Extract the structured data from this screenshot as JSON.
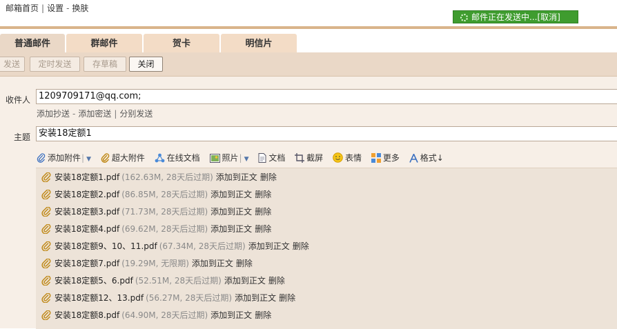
{
  "topnav": {
    "home": "邮箱首页",
    "settings": "设置",
    "skin": "换肤"
  },
  "status": {
    "text": "邮件正在发送中...",
    "cancel": "[取消]"
  },
  "tabs": [
    {
      "label": "普通邮件"
    },
    {
      "label": "群邮件"
    },
    {
      "label": "贺卡"
    },
    {
      "label": "明信片"
    }
  ],
  "toolbar": {
    "send": "发送",
    "scheduled": "定时发送",
    "draft": "存草稿",
    "close": "关闭"
  },
  "compose": {
    "to_label": "收件人",
    "to_value": "1209709171@qq.com;",
    "cc_add": "添加抄送",
    "bcc_add": "添加密送",
    "separate": "分别发送",
    "subject_label": "主题",
    "subject_value": "安装18定额1"
  },
  "attach_bar": {
    "add": "添加附件",
    "big": "超大附件",
    "online_doc": "在线文档",
    "photo": "照片",
    "doc": "文档",
    "screenshot": "截屏",
    "emoji": "表情",
    "more": "更多",
    "format": "格式↓"
  },
  "attachments": [
    {
      "name": "安装18定额1.pdf",
      "meta": "(162.63M, 28天后过期)",
      "add": "添加到正文",
      "del": "删除"
    },
    {
      "name": "安装18定额2.pdf",
      "meta": "(86.85M, 28天后过期)",
      "add": "添加到正文",
      "del": "删除"
    },
    {
      "name": "安装18定额3.pdf",
      "meta": "(71.73M, 28天后过期)",
      "add": "添加到正文",
      "del": "删除"
    },
    {
      "name": "安装18定额4.pdf",
      "meta": "(69.62M, 28天后过期)",
      "add": "添加到正文",
      "del": "删除"
    },
    {
      "name": "安装18定额9、10、11.pdf",
      "meta": "(67.34M, 28天后过期)",
      "add": "添加到正文",
      "del": "删除"
    },
    {
      "name": "安装18定额7.pdf",
      "meta": "(19.29M, 无限期)",
      "add": "添加到正文",
      "del": "删除"
    },
    {
      "name": "安装18定额5、6.pdf",
      "meta": "(52.51M, 28天后过期)",
      "add": "添加到正文",
      "del": "删除"
    },
    {
      "name": "安装18定额12、13.pdf",
      "meta": "(56.27M, 28天后过期)",
      "add": "添加到正文",
      "del": "删除"
    },
    {
      "name": "安装18定额8.pdf",
      "meta": "(64.90M, 28天后过期)",
      "add": "添加到正文",
      "del": "删除"
    }
  ]
}
